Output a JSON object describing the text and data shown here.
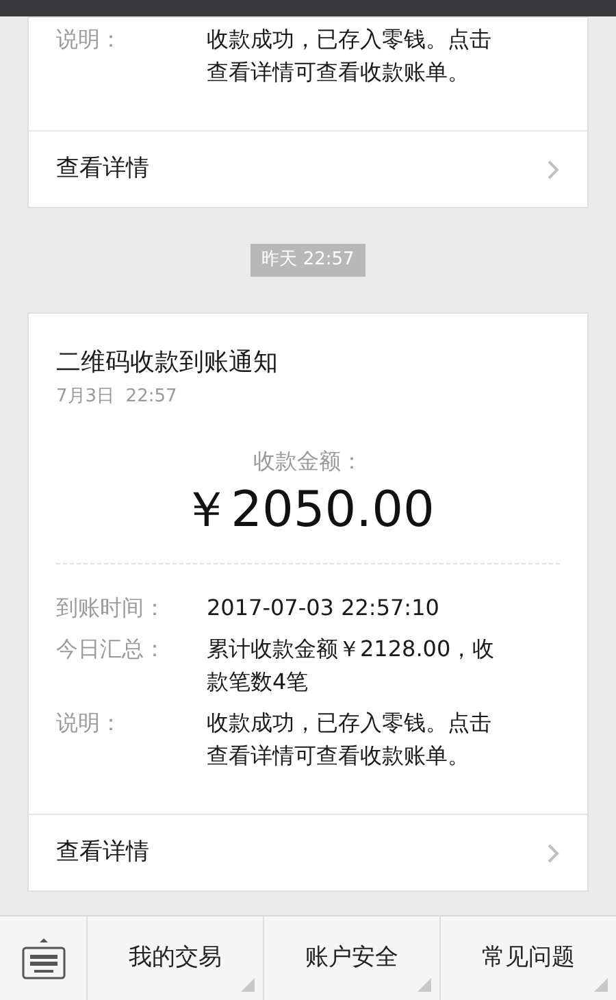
{
  "previous_card": {
    "rows": [
      {
        "label": "说明：",
        "value": "收款成功，已存入零钱。点击查看详情可查看收款账单。"
      }
    ],
    "details_link": "查看详情"
  },
  "timestamp": "昨天 22:57",
  "card": {
    "title": "二维码收款到账通知",
    "date": "7月3日  22:57",
    "amount_label": "收款金额：",
    "amount": "￥2050.00",
    "rows": [
      {
        "label": "到账时间：",
        "value": "2017-07-03 22:57:10"
      },
      {
        "label": "今日汇总：",
        "value": "累计收款金额￥2128.00，收款笔数4笔"
      },
      {
        "label": "说明：",
        "value": "收款成功，已存入零钱。点击查看详情可查看收款账单。"
      }
    ],
    "details_link": "查看详情"
  },
  "menu": [
    "我的交易",
    "账户安全",
    "常见问题"
  ]
}
